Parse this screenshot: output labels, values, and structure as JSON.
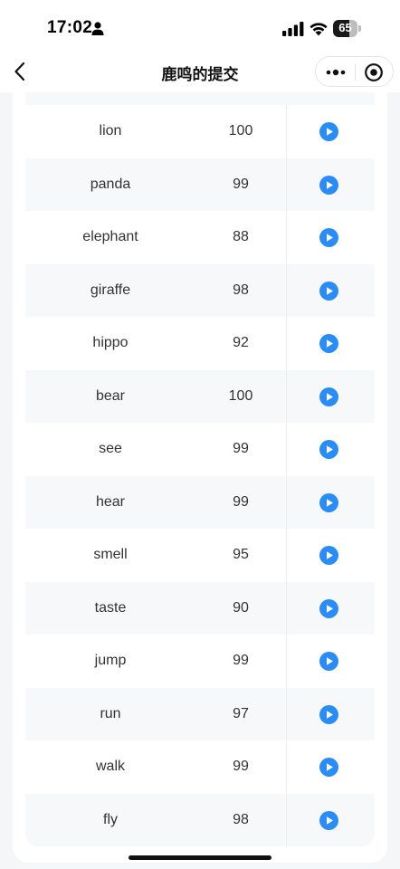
{
  "status_bar": {
    "time": "17:02",
    "battery_level": "65",
    "battery_fraction": 0.65,
    "icons": [
      "person-icon",
      "signal-icon",
      "wifi-icon",
      "battery-icon"
    ]
  },
  "nav": {
    "title": "鹿鸣的提交",
    "back_icon": "chevron-left-icon",
    "more_icon": "more-dots-icon",
    "target_icon": "record-target-icon"
  },
  "table": {
    "rows": [
      {
        "word": "lion",
        "score": "100"
      },
      {
        "word": "panda",
        "score": "99"
      },
      {
        "word": "elephant",
        "score": "88"
      },
      {
        "word": "giraffe",
        "score": "98"
      },
      {
        "word": "hippo",
        "score": "92"
      },
      {
        "word": "bear",
        "score": "100"
      },
      {
        "word": "see",
        "score": "99"
      },
      {
        "word": "hear",
        "score": "99"
      },
      {
        "word": "smell",
        "score": "95"
      },
      {
        "word": "taste",
        "score": "90"
      },
      {
        "word": "jump",
        "score": "99"
      },
      {
        "word": "run",
        "score": "97"
      },
      {
        "word": "walk",
        "score": "99"
      },
      {
        "word": "fly",
        "score": "98"
      }
    ],
    "play_icon": "play-circle-icon"
  },
  "colors": {
    "accent": "#2a8cf4",
    "row_alt": "#f7f8fa",
    "background": "#f5f6f8"
  }
}
